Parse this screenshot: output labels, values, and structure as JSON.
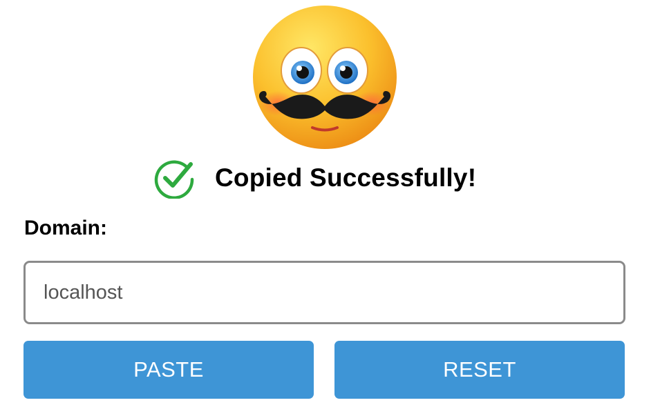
{
  "app": {
    "logo_icon": "mustache-emoji-icon"
  },
  "status": {
    "icon": "check-circle-icon",
    "icon_color": "#2eaa3f",
    "text": "Copied Successfully!"
  },
  "domain": {
    "label": "Domain:",
    "value": "localhost"
  },
  "actions": {
    "paste_label": "PASTE",
    "reset_label": "RESET",
    "button_color": "#3e95d6"
  }
}
